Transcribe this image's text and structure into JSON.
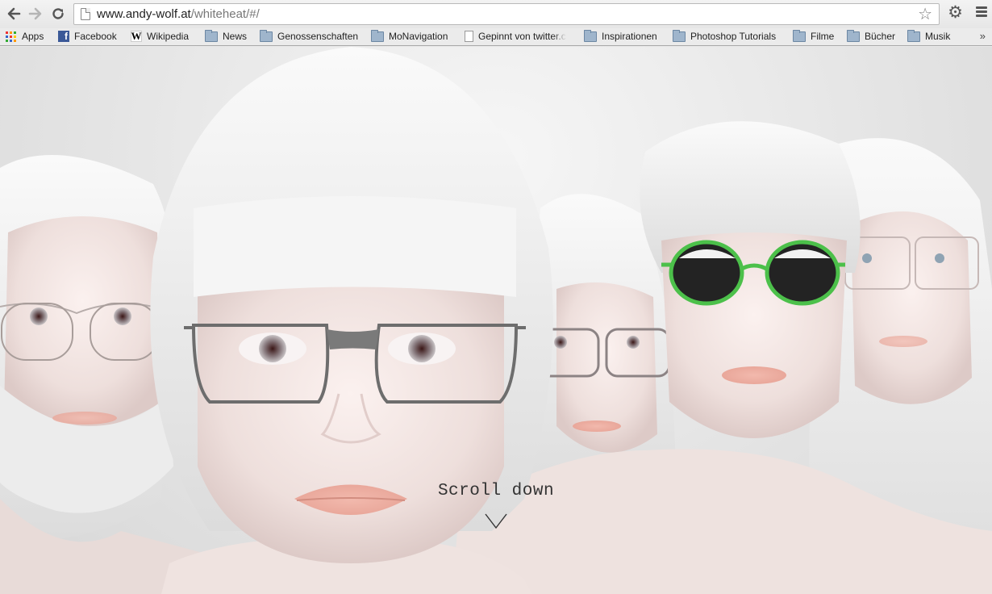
{
  "browser": {
    "url_host": "www.andy-wolf.at",
    "url_path": "/whiteheat/#/"
  },
  "bookmarks": [
    {
      "label": "Apps",
      "icon": "apps-icon"
    },
    {
      "label": "Facebook",
      "icon": "facebook-icon"
    },
    {
      "label": "Wikipedia",
      "icon": "wikipedia-icon"
    },
    {
      "label": "News",
      "icon": "folder-icon"
    },
    {
      "label": "Genossenschaften",
      "icon": "folder-icon"
    },
    {
      "label": "MoNavigation",
      "icon": "folder-icon"
    },
    {
      "label": "Gepinnt von twitter.c",
      "icon": "page-icon"
    },
    {
      "label": "Inspirationen",
      "icon": "folder-icon"
    },
    {
      "label": "Photoshop Tutorials",
      "icon": "folder-icon"
    },
    {
      "label": "Filme",
      "icon": "folder-icon"
    },
    {
      "label": "Bücher",
      "icon": "folder-icon"
    },
    {
      "label": "Musik",
      "icon": "folder-icon"
    }
  ],
  "page": {
    "scroll_label": "Scroll down"
  },
  "colors": {
    "background": "#e6e6e6",
    "skin": "#f1e4e2",
    "hair": "#f3f3f3",
    "accent_frame": "#4cc04a",
    "text": "#333333"
  }
}
